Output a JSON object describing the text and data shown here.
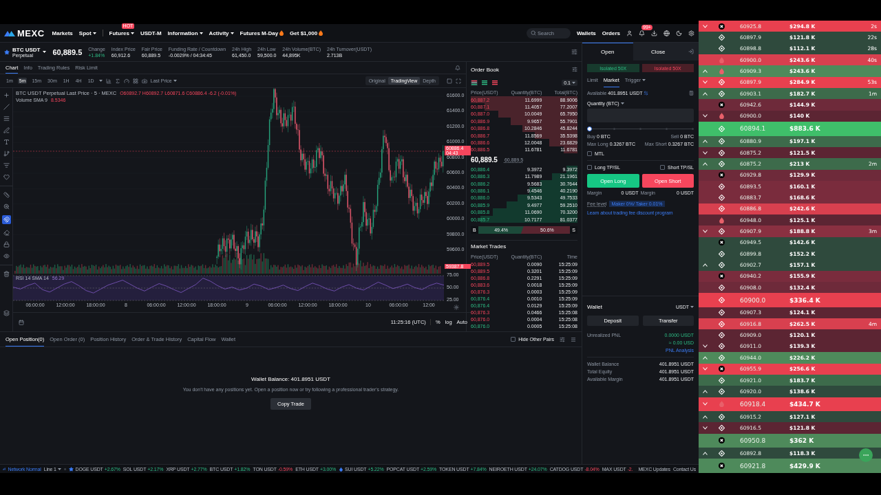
{
  "header": {
    "logo": "MEXC",
    "nav": [
      {
        "label": "Markets",
        "dropdown": false,
        "fire": false
      },
      {
        "label": "Spot",
        "dropdown": true,
        "fire": false
      },
      {
        "label": "Futures",
        "dropdown": true,
        "fire": false,
        "badge": "HOT"
      },
      {
        "label": "USDT-M",
        "dropdown": false,
        "fire": false
      },
      {
        "label": "Information",
        "dropdown": true,
        "fire": false
      },
      {
        "label": "Activity",
        "dropdown": true,
        "fire": false
      },
      {
        "label": "Futures M-Day",
        "dropdown": false,
        "fire": true
      },
      {
        "label": "Get $1,000",
        "dropdown": false,
        "fire": true
      }
    ],
    "search": {
      "placeholder": "Search"
    },
    "links": [
      "Wallets",
      "Orders"
    ],
    "notification_badge": "99+"
  },
  "ticker": {
    "symbol": "BTC USDT",
    "subtitle": "Perpetual",
    "price": "60,889.5",
    "stats": [
      {
        "label": "Change",
        "value": "+1.84%",
        "kind": "up"
      },
      {
        "label": "Index Price",
        "value": "60,912.6",
        "kind": "flat"
      },
      {
        "label": "Fair Price",
        "value": "60,889.5",
        "kind": "flat"
      },
      {
        "label": "Funding Rate / Countdown",
        "value": "-0.0029% / 04:34:45",
        "kind": "flat"
      },
      {
        "label": "24h High",
        "value": "61,450.0",
        "kind": "flat"
      },
      {
        "label": "24h Low",
        "value": "59,500.0",
        "kind": "flat"
      },
      {
        "label": "24h Volume(BTC)",
        "value": "44,895K",
        "kind": "flat"
      },
      {
        "label": "24h Turnover(USDT)",
        "value": "2.713B",
        "kind": "flat"
      }
    ]
  },
  "chart": {
    "tabs": [
      {
        "label": "Chart",
        "selected": true
      },
      {
        "label": "Info",
        "selected": false
      },
      {
        "label": "Trading Rules",
        "selected": false
      },
      {
        "label": "Risk Limit",
        "selected": false
      }
    ],
    "intervals": [
      {
        "label": "1m",
        "selected": false
      },
      {
        "label": "5m",
        "selected": true
      },
      {
        "label": "15m",
        "selected": false
      },
      {
        "label": "30m",
        "selected": false
      },
      {
        "label": "1H",
        "selected": false
      },
      {
        "label": "4H",
        "selected": false
      },
      {
        "label": "1D",
        "selected": false
      }
    ],
    "price_type": "Last Price",
    "views": [
      {
        "label": "Original",
        "selected": false
      },
      {
        "label": "TradingView",
        "selected": true
      },
      {
        "label": "Depth",
        "selected": false
      }
    ],
    "magnet_on": true,
    "legend_title": "BTC USDT Perpetual Last Price · 5 · MEXC",
    "legend_ohlc": "O60892.7 H60892.7 L60871.6 C60886.4 -6.2 (-0.01%)",
    "volume_label": "Volume SMA 9",
    "volume_value": "8.5346",
    "price_axis": [
      "61600.0",
      "61400.0",
      "61200.0",
      "61000.0",
      "60800.0",
      "60600.0",
      "60400.0",
      "60200.0",
      "60000.0",
      "59800.0",
      "59600.0"
    ],
    "last_price_tag": "60886.4",
    "countdown_tag": "04:43",
    "volume_tag": "59387.8",
    "rsi_value": "56.29",
    "rsi_chart": {
      "chart_data": {
        "type": "line",
        "ylim": [
          25,
          75
        ],
        "grid": true,
        "yticks": [
          {
            "value": 75,
            "label": "75.00"
          },
          {
            "value": 50,
            "label": "50.00"
          },
          {
            "value": 25,
            "label": "25.00"
          }
        ],
        "series": [
          {
            "name": "RSI 14 SMA 14",
            "color": "#7e57c2",
            "values": [
              52,
              48,
              55,
              60,
              47,
              42,
              50,
              58,
              63,
              55,
              45,
              40,
              48,
              56,
              61,
              66,
              58,
              50,
              44,
              52,
              59,
              54,
              47,
              41,
              49,
              57,
              70,
              64,
              55,
              48,
              52,
              46,
              50,
              58,
              54,
              47,
              51,
              56,
              49,
              45,
              53,
              60,
              55,
              48,
              44,
              52,
              57,
              50,
              46,
              54,
              62,
              56,
              49,
              53,
              58,
              51,
              47,
              55,
              60,
              56
            ]
          }
        ]
      }
    },
    "time_axis": [
      "06:00:00",
      "12:00:00",
      "18:00:00",
      "8",
      "06:00:00",
      "12:00:00",
      "18:00:00",
      "9",
      "06:00:00",
      "12:00:00",
      "18:00:00",
      "10",
      "06:00:00",
      "12:00"
    ],
    "clock": "11:25:16 (UTC)",
    "scale_options": [
      "%",
      "log",
      "Auto"
    ]
  },
  "order_book": {
    "title": "Order Book",
    "views": [
      {
        "selected": true
      },
      {
        "selected": false
      },
      {
        "selected": false
      }
    ],
    "precision": "0.1",
    "columns": [
      "Price(USDT)",
      "Quantity(BTC)",
      "Total(BTC)"
    ],
    "asks": [
      {
        "price": "60,887.2",
        "quantity": "11.6999",
        "total": "88.9006"
      },
      {
        "price": "60,887.1",
        "quantity": "11.4057",
        "total": "77.2007"
      },
      {
        "price": "60,887.0",
        "quantity": "10.0049",
        "total": "65.7950"
      },
      {
        "price": "60,886.9",
        "quantity": "9.9657",
        "total": "55.7901"
      },
      {
        "price": "60,886.8",
        "quantity": "10.2846",
        "total": "45.8244"
      },
      {
        "price": "60,886.7",
        "quantity": "11.8569",
        "total": "35.5398"
      },
      {
        "price": "60,886.6",
        "quantity": "12.0048",
        "total": "23.6829"
      },
      {
        "price": "60,886.5",
        "quantity": "11.6781",
        "total": "11.6781"
      }
    ],
    "last_price": "60,889.5",
    "mark_price": "60,889.5",
    "bids": [
      {
        "price": "60,886.4",
        "quantity": "9.3972",
        "total": "9.3972"
      },
      {
        "price": "60,886.3",
        "quantity": "11.7989",
        "total": "21.1961"
      },
      {
        "price": "60,886.2",
        "quantity": "9.5683",
        "total": "30.7644"
      },
      {
        "price": "60,886.1",
        "quantity": "9.4546",
        "total": "40.2190"
      },
      {
        "price": "60,886.0",
        "quantity": "9.5343",
        "total": "49.7533"
      },
      {
        "price": "60,885.9",
        "quantity": "9.4977",
        "total": "59.2510"
      },
      {
        "price": "60,885.8",
        "quantity": "11.0690",
        "total": "70.3200"
      },
      {
        "price": "60,885.7",
        "quantity": "10.7177",
        "total": "81.0377"
      }
    ],
    "ratio": {
      "buy_label": "B",
      "buy": "49.4%",
      "sell": "50.6%",
      "sell_label": "S",
      "level": 0.494
    }
  },
  "market_trades": {
    "title": "Market Trades",
    "columns": [
      "Price(USDT)",
      "Quantity(BTC)",
      "Time"
    ],
    "rows": [
      {
        "price": "60,889.5",
        "kind": "sell",
        "quantity": "0.0090",
        "time": "15:25:09"
      },
      {
        "price": "60,889.5",
        "kind": "sell",
        "quantity": "0.3201",
        "time": "15:25:09"
      },
      {
        "price": "60,886.8",
        "kind": "sell",
        "quantity": "0.2291",
        "time": "15:25:09"
      },
      {
        "price": "60,883.6",
        "kind": "sell",
        "quantity": "0.0018",
        "time": "15:25:09"
      },
      {
        "price": "60,876.3",
        "kind": "sell",
        "quantity": "0.0003",
        "time": "15:25:09"
      },
      {
        "price": "60,876.4",
        "kind": "buy",
        "quantity": "0.0010",
        "time": "15:25:09"
      },
      {
        "price": "60,876.4",
        "kind": "buy",
        "quantity": "0.0129",
        "time": "15:25:09"
      },
      {
        "price": "60,876.3",
        "kind": "sell",
        "quantity": "0.0466",
        "time": "15:25:08"
      },
      {
        "price": "60,876.0",
        "kind": "sell",
        "quantity": "0.0004",
        "time": "15:25:08"
      },
      {
        "price": "60,876.0",
        "kind": "buy",
        "quantity": "0.0005",
        "time": "15:25:08"
      }
    ]
  },
  "trade_panel": {
    "tabs": [
      {
        "label": "Open",
        "selected": true
      },
      {
        "label": "Close",
        "selected": false
      }
    ],
    "margin_modes": [
      {
        "label": "Isolated 50X",
        "kind": "long"
      },
      {
        "label": "Isolated 50X",
        "kind": "short"
      }
    ],
    "order_types": [
      {
        "label": "Limit",
        "selected": false,
        "dropdown": false
      },
      {
        "label": "Market",
        "selected": true,
        "dropdown": false
      },
      {
        "label": "Trigger",
        "selected": false,
        "dropdown": true
      }
    ],
    "available_label": "Available",
    "available": "401.8951 USDT",
    "quantity_label": "Quantity (BTC)",
    "slider": {
      "level": 0
    },
    "buy_label": "Buy",
    "buy": "0 BTC",
    "sell_label": "Sell",
    "sell": "0 BTC",
    "max_long_label": "Max Long",
    "max_long": "0.3267 BTC",
    "max_short_label": "Max Short",
    "max_short": "0.3267 BTC",
    "mtl": {
      "label": "MTL",
      "checked": false
    },
    "long_tpsl": {
      "label": "Long TP/SL",
      "checked": false
    },
    "short_tpsl": {
      "label": "Short TP/SL",
      "checked": false
    },
    "buttons": [
      {
        "label": "Open Long",
        "kind": "long"
      },
      {
        "label": "Open Short",
        "kind": "short"
      }
    ],
    "margins": [
      {
        "label": "Margin",
        "value": "0 USDT"
      },
      {
        "label": "Margin",
        "value": "0 USDT"
      }
    ],
    "fee_label": "Fee level",
    "fee": "Maker 0%/ Taker 0.01%",
    "fee_link": "Learn about trading fee discount program"
  },
  "wallet": {
    "title": "Wallet",
    "currency": "USDT",
    "buttons": [
      "Deposit",
      "Transfer"
    ],
    "pnl_label": "Unrealized PNL",
    "pnl": "0.0000 USDT",
    "pnl_usd": "≈ 0.00 USD",
    "pnl_link": "PNL Analysis",
    "rows": [
      {
        "label": "Wallet Balance",
        "value": "401.8951 USDT"
      },
      {
        "label": "Total Equity",
        "value": "401.8951 USDT"
      },
      {
        "label": "Available Margin",
        "value": "401.8951 USDT"
      }
    ]
  },
  "positions": {
    "tabs": [
      {
        "label": "Open Position(0)",
        "selected": true
      },
      {
        "label": "Open Order (0)",
        "selected": false
      },
      {
        "label": "Position History",
        "selected": false
      },
      {
        "label": "Order & Trade History",
        "selected": false
      },
      {
        "label": "Capital Flow",
        "selected": false
      },
      {
        "label": "Wallet",
        "selected": false
      }
    ],
    "hide_other_pairs": {
      "label": "Hide Other Pairs",
      "checked": false
    },
    "balance": "Wallet Balance: 401.8951 USDT",
    "message": "You don't have any positions yet. Open a position now or try following a professional trader's strategy.",
    "button": "Copy Trade"
  },
  "status_bar": {
    "network": "Network Normal",
    "line": "Line 1",
    "tickers": [
      {
        "symbol": "DOGE USDT",
        "change": "+2.67%",
        "kind": "up",
        "favorite": true,
        "drop": false
      },
      {
        "symbol": "SOL USDT",
        "change": "+2.17%",
        "kind": "up",
        "favorite": false,
        "drop": false
      },
      {
        "symbol": "XRP USDT",
        "change": "+2.77%",
        "kind": "up",
        "favorite": false,
        "drop": false
      },
      {
        "symbol": "BTC USDT",
        "change": "+1.82%",
        "kind": "up",
        "favorite": false,
        "drop": false
      },
      {
        "symbol": "TON USDT",
        "change": "-0.59%",
        "kind": "down",
        "favorite": false,
        "drop": false
      },
      {
        "symbol": "ETH USDT",
        "change": "+3.00%",
        "kind": "up",
        "favorite": false,
        "drop": false
      },
      {
        "symbol": "SUI USDT",
        "change": "+5.22%",
        "kind": "up",
        "favorite": false,
        "drop": true
      },
      {
        "symbol": "POPCAT USDT",
        "change": "+2.59%",
        "kind": "up",
        "favorite": false,
        "drop": false
      },
      {
        "symbol": "TOKEN USDT",
        "change": "+7.84%",
        "kind": "up",
        "favorite": false,
        "drop": false
      },
      {
        "symbol": "NEIROETH USDT",
        "change": "+24.07%",
        "kind": "up",
        "favorite": false,
        "drop": false
      },
      {
        "symbol": "CATDOG USDT",
        "change": "-8.04%",
        "kind": "down",
        "favorite": false,
        "drop": false
      },
      {
        "symbol": "MAX USDT",
        "change": "-2.",
        "kind": "down",
        "favorite": false,
        "drop": false
      }
    ],
    "links": [
      "MEXC Updates",
      "Contact Us"
    ]
  },
  "feed": [
    {
      "arrow_up": false,
      "arrow_down": true,
      "kind": "x",
      "price": "60925.8",
      "amount": "$294.8 K",
      "time": "2s",
      "large": false,
      "color": "#e8404f"
    },
    {
      "arrow_up": false,
      "arrow_down": false,
      "kind": "diamond",
      "price": "60897.9",
      "amount": "$121.8 K",
      "time": "22s",
      "large": false,
      "color": "#2f4a3d"
    },
    {
      "arrow_up": false,
      "arrow_down": false,
      "kind": "diamond",
      "price": "60898.8",
      "amount": "$112.1 K",
      "time": "28s",
      "large": false,
      "color": "#2f4a3d"
    },
    {
      "arrow_up": false,
      "arrow_down": false,
      "kind": "fire",
      "price": "60900.0",
      "amount": "$243.6 K",
      "time": "40s",
      "large": false,
      "color": "#d8404f"
    },
    {
      "arrow_up": true,
      "arrow_down": false,
      "kind": "fire",
      "price": "60909.3",
      "amount": "$243.6 K",
      "large": false,
      "color": "#4e8a5b"
    },
    {
      "arrow_up": false,
      "arrow_down": true,
      "kind": "diamond",
      "price": "60897.9",
      "amount": "$284.9 K",
      "time": "53s",
      "large": false,
      "color": "#e8404f"
    },
    {
      "arrow_up": true,
      "arrow_down": false,
      "kind": "diamond",
      "price": "60903.1",
      "amount": "$182.7 K",
      "time": "1m",
      "large": false,
      "color": "#3d6b4b"
    },
    {
      "arrow_up": false,
      "arrow_down": false,
      "kind": "x",
      "price": "60942.6",
      "amount": "$144.9 K",
      "large": false,
      "color": "#6e2a3a"
    },
    {
      "arrow_up": false,
      "arrow_down": true,
      "kind": "fire",
      "price": "60900.0",
      "amount": "$140 K",
      "large": false,
      "color": "#5c2533"
    },
    {
      "arrow_up": false,
      "arrow_down": false,
      "kind": "diamond",
      "price": "60894.1",
      "amount": "$883.6 K",
      "large": true,
      "color": "#3fbf6a"
    },
    {
      "arrow_up": true,
      "arrow_down": false,
      "kind": "diamond",
      "price": "60880.9",
      "amount": "$197.1 K",
      "large": false,
      "color": "#3d6b4b"
    },
    {
      "arrow_up": false,
      "arrow_down": true,
      "kind": "diamond",
      "price": "60875.2",
      "amount": "$121.5 K",
      "large": false,
      "color": "#5c2533"
    },
    {
      "arrow_up": true,
      "arrow_down": false,
      "kind": "diamond",
      "price": "60875.2",
      "amount": "$213 K",
      "time": "2m",
      "large": false,
      "color": "#3d6b4b"
    },
    {
      "arrow_up": false,
      "arrow_down": false,
      "kind": "x",
      "price": "60929.8",
      "amount": "$129.9 K",
      "large": false,
      "color": "#6e2a3a"
    },
    {
      "arrow_up": false,
      "arrow_down": false,
      "kind": "diamond",
      "price": "60893.5",
      "amount": "$160.1 K",
      "large": false,
      "color": "#7a2c3d"
    },
    {
      "arrow_up": false,
      "arrow_down": false,
      "kind": "diamond",
      "price": "60883.7",
      "amount": "$168.6 K",
      "large": false,
      "color": "#7a2c3d"
    },
    {
      "arrow_up": false,
      "arrow_down": false,
      "kind": "diamond",
      "price": "60886.8",
      "amount": "$242.6 K",
      "large": false,
      "color": "#d8404f"
    },
    {
      "arrow_up": false,
      "arrow_down": false,
      "kind": "fire",
      "price": "60948.0",
      "amount": "$125.1 K",
      "large": false,
      "color": "#5c2533"
    },
    {
      "arrow_up": false,
      "arrow_down": true,
      "kind": "diamond",
      "price": "60907.9",
      "amount": "$188.8 K",
      "time": "3m",
      "large": false,
      "color": "#8a3041"
    },
    {
      "arrow_up": false,
      "arrow_down": false,
      "kind": "x",
      "price": "60949.5",
      "amount": "$142.6 K",
      "large": false,
      "color": "#2f4a3d"
    },
    {
      "arrow_up": false,
      "arrow_down": false,
      "kind": "diamond",
      "price": "60899.8",
      "amount": "$152.2 K",
      "large": false,
      "color": "#2f4a3d"
    },
    {
      "arrow_up": true,
      "arrow_down": false,
      "kind": "diamond",
      "price": "60902.7",
      "amount": "$157.1 K",
      "large": false,
      "color": "#2f4a3d"
    },
    {
      "arrow_up": false,
      "arrow_down": false,
      "kind": "x",
      "price": "60940.2",
      "amount": "$155.9 K",
      "large": false,
      "color": "#7a2c3d"
    },
    {
      "arrow_up": false,
      "arrow_down": false,
      "kind": "diamond",
      "price": "60908.0",
      "amount": "$132.4 K",
      "large": false,
      "color": "#6e2a3a"
    },
    {
      "arrow_up": false,
      "arrow_down": false,
      "kind": "diamond",
      "price": "60900.0",
      "amount": "$336.4 K",
      "large": true,
      "color": "#e8404f"
    },
    {
      "arrow_up": false,
      "arrow_down": false,
      "kind": "diamond",
      "price": "60907.3",
      "amount": "$124.1 K",
      "large": false,
      "color": "#5c2533"
    },
    {
      "arrow_up": false,
      "arrow_down": false,
      "kind": "diamond",
      "price": "60916.8",
      "amount": "$262.5 K",
      "time": "4m",
      "large": false,
      "color": "#d8404f"
    },
    {
      "arrow_up": false,
      "arrow_down": false,
      "kind": "diamond",
      "price": "60909.0",
      "amount": "$120.1 K",
      "large": false,
      "color": "#5c2533"
    },
    {
      "arrow_up": false,
      "arrow_down": true,
      "kind": "diamond",
      "price": "60911.0",
      "amount": "$139.3 K",
      "large": false,
      "color": "#5c2533"
    },
    {
      "arrow_up": true,
      "arrow_down": false,
      "kind": "diamond",
      "price": "60944.0",
      "amount": "$226.2 K",
      "large": false,
      "color": "#4e8a5b"
    },
    {
      "arrow_up": false,
      "arrow_down": true,
      "kind": "x",
      "price": "60955.9",
      "amount": "$256.6 K",
      "large": false,
      "color": "#e8404f"
    },
    {
      "arrow_up": false,
      "arrow_down": false,
      "kind": "diamond",
      "price": "60921.0",
      "amount": "$183.7 K",
      "large": false,
      "color": "#3d6b4b"
    },
    {
      "arrow_up": true,
      "arrow_down": false,
      "kind": "diamond",
      "price": "60920.0",
      "amount": "$138.6 K",
      "large": false,
      "color": "#2f4a3d"
    },
    {
      "arrow_up": false,
      "arrow_down": true,
      "kind": "fire",
      "price": "60918.4",
      "amount": "$434.7 K",
      "large": true,
      "color": "#e8404f"
    },
    {
      "arrow_up": true,
      "arrow_down": false,
      "kind": "diamond",
      "price": "60915.2",
      "amount": "$127.1 K",
      "large": false,
      "color": "#2f4a3d"
    },
    {
      "arrow_up": false,
      "arrow_down": true,
      "kind": "diamond",
      "price": "60916.5",
      "amount": "$121.8 K",
      "large": false,
      "color": "#5c2533"
    },
    {
      "arrow_up": false,
      "arrow_down": false,
      "kind": "x",
      "price": "60950.8",
      "amount": "$362 K",
      "large": true,
      "color": "#4e8a5b"
    },
    {
      "arrow_up": true,
      "arrow_down": false,
      "kind": "diamond",
      "price": "60892.8",
      "amount": "$118.3 K",
      "large": false,
      "color": "#2f4a3d"
    },
    {
      "arrow_up": false,
      "arrow_down": false,
      "kind": "x",
      "price": "60921.8",
      "amount": "$429.9 K",
      "large": true,
      "color": "#4e8a5b"
    }
  ]
}
